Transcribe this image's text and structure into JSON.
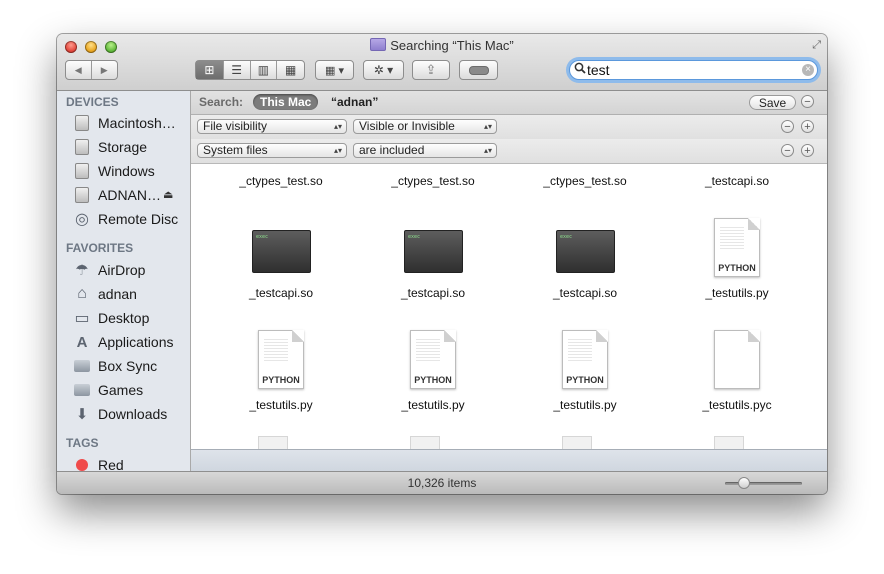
{
  "window": {
    "title": "Searching “This Mac”",
    "fullscreen_glyph": "⤢"
  },
  "toolbar": {
    "back_glyph": "◀",
    "forward_glyph": "▶",
    "view_icon_glyph": "⊞",
    "view_list_glyph": "☰",
    "view_column_glyph": "▥",
    "view_coverflow_glyph": "▦",
    "arrange_glyph": "▦ ▾",
    "action_glyph": "✲ ▾",
    "share_glyph": "⇪",
    "tag_glyph": "⬭",
    "active_view": "icon"
  },
  "search": {
    "value": "test",
    "search_icon_glyph": "🔍",
    "clear_glyph": "×"
  },
  "sidebar": {
    "devices_header": "DEVICES",
    "devices": [
      {
        "label": "Macintosh…",
        "icon": "hard-disk-icon"
      },
      {
        "label": "Storage",
        "icon": "hard-disk-icon"
      },
      {
        "label": "Windows",
        "icon": "hard-disk-icon"
      },
      {
        "label": "ADNAN…",
        "icon": "external-disk-icon",
        "eject": "⏏"
      },
      {
        "label": "Remote Disc",
        "icon": "optical-disc-icon",
        "glyph": "◎"
      }
    ],
    "favorites_header": "FAVORITES",
    "favorites": [
      {
        "label": "AirDrop",
        "icon": "airdrop-icon",
        "glyph": "☂"
      },
      {
        "label": "adnan",
        "icon": "home-icon",
        "glyph": "⌂"
      },
      {
        "label": "Desktop",
        "icon": "desktop-icon",
        "glyph": "▭"
      },
      {
        "label": "Applications",
        "icon": "applications-icon",
        "glyph": "A"
      },
      {
        "label": "Box Sync",
        "icon": "folder-icon"
      },
      {
        "label": "Games",
        "icon": "folder-icon"
      },
      {
        "label": "Downloads",
        "icon": "downloads-icon",
        "glyph": "⬇"
      }
    ],
    "tags_header": "TAGS",
    "tags": [
      {
        "label": "Red",
        "color": "#f04b4b"
      }
    ]
  },
  "scope": {
    "label": "Search:",
    "this_mac": "This Mac",
    "user": "“adnan”",
    "save_label": "Save",
    "minus_glyph": "−"
  },
  "criteria": [
    {
      "attribute": "File visibility",
      "operator": "Visible or Invisible"
    },
    {
      "attribute": "System files",
      "operator": "are included"
    }
  ],
  "criteria_buttons": {
    "remove": "−",
    "add": "+"
  },
  "files": [
    {
      "name": "_ctypes_test.so",
      "kind": "none"
    },
    {
      "name": "_ctypes_test.so",
      "kind": "none"
    },
    {
      "name": "_ctypes_test.so",
      "kind": "none"
    },
    {
      "name": "_testcapi.so",
      "kind": "none"
    },
    {
      "name": "_testcapi.so",
      "kind": "exec"
    },
    {
      "name": "_testcapi.so",
      "kind": "exec"
    },
    {
      "name": "_testcapi.so",
      "kind": "exec"
    },
    {
      "name": "_testutils.py",
      "kind": "python"
    },
    {
      "name": "_testutils.py",
      "kind": "python"
    },
    {
      "name": "_testutils.py",
      "kind": "python"
    },
    {
      "name": "_testutils.py",
      "kind": "python"
    },
    {
      "name": "_testutils.pyc",
      "kind": "blank"
    }
  ],
  "exec_thumb_text": "exec",
  "python_badge": "PYTHON",
  "status": {
    "item_count": "10,326 items",
    "icon_size_level": 0.2
  }
}
